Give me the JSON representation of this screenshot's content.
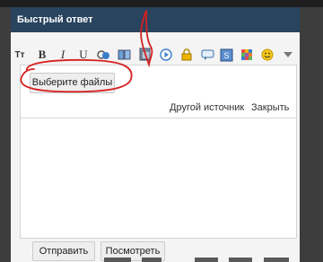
{
  "header": {
    "title": "Быстрый ответ"
  },
  "toolbar": {
    "font_size_label": "Tт",
    "bold_label": "B",
    "italic_label": "I",
    "underline_label": "U"
  },
  "upload": {
    "choose_files_label": "Выберите файлы",
    "other_source_label": "Другой источник",
    "close_label": "Закрыть"
  },
  "actions": {
    "send_label": "Отправить",
    "preview_label": "Посмотреть"
  },
  "colors": {
    "header_bg": "#28445f",
    "annotation_red": "#d61f1f"
  }
}
